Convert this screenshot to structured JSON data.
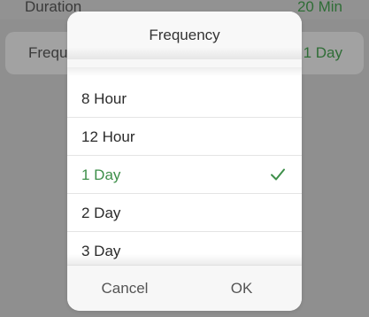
{
  "background": {
    "duration_label": "Duration",
    "duration_value": "20 Min",
    "frequency_label": "Frequ",
    "frequency_value": "1 Day"
  },
  "picker": {
    "title": "Frequency",
    "options": [
      {
        "label": "8 Hour",
        "selected": false
      },
      {
        "label": "12 Hour",
        "selected": false
      },
      {
        "label": "1 Day",
        "selected": true
      },
      {
        "label": "2 Day",
        "selected": false
      },
      {
        "label": "3 Day",
        "selected": false
      }
    ],
    "selected_check_icon": "checkmark-icon",
    "cancel_label": "Cancel",
    "ok_label": "OK"
  },
  "colors": {
    "accent": "#3e8f4a",
    "overlay": "#8f8f8f"
  }
}
